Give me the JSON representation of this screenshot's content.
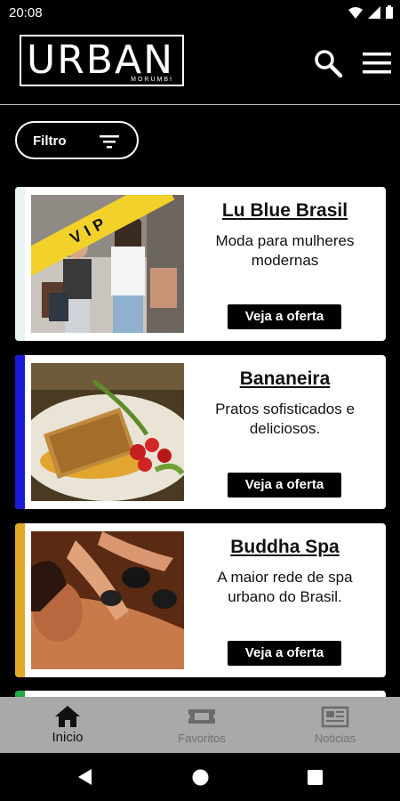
{
  "status_bar": {
    "time": "20:08",
    "icons": [
      "wifi-icon",
      "signal-icon",
      "battery-icon"
    ]
  },
  "header": {
    "logo_text": "URBAN",
    "logo_subtext": "MORUMBI",
    "icons": [
      "search-icon",
      "menu-icon"
    ]
  },
  "filter": {
    "label": "Filtro",
    "icon": "filter-icon"
  },
  "cards": [
    {
      "title": "Lu Blue Brasil",
      "description": "Moda para mulheres modernas",
      "button_label": "Veja a oferta",
      "badge": "VIP",
      "accent_color": "#ffffff",
      "image": "shopping-women-photo"
    },
    {
      "title": "Bananeira",
      "description": "Pratos sofisticados e deliciosos.",
      "button_label": "Veja a oferta",
      "accent_color": "#1a1adb",
      "image": "fish-dish-photo"
    },
    {
      "title": "Buddha Spa",
      "description": "A maior rede de spa urbano do Brasil.",
      "button_label": "Veja a oferta",
      "accent_color": "#e0a826",
      "image": "spa-massage-photo"
    }
  ],
  "bottom_nav": {
    "items": [
      {
        "label": "Inicio",
        "icon": "home-icon",
        "active": true
      },
      {
        "label": "Favoritos",
        "icon": "ticket-icon",
        "active": false
      },
      {
        "label": "Noticias",
        "icon": "newspaper-icon",
        "active": false
      }
    ]
  },
  "colors": {
    "background": "#000000",
    "card": "#ffffff",
    "nav_bar": "#a9a9a9",
    "vip_ribbon": "#f2d22a"
  }
}
